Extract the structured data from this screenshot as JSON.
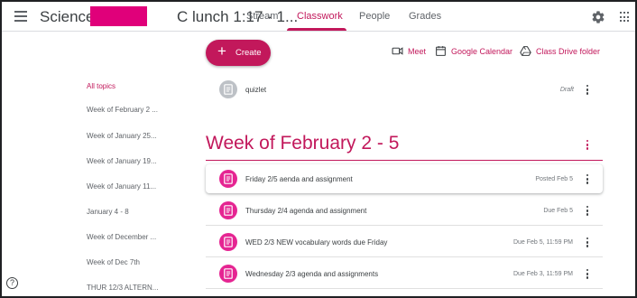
{
  "header": {
    "class_title_prefix": "Science P4",
    "class_title_suffix": "C lunch 1:17 - 1...",
    "tabs": [
      {
        "label": "Stream",
        "active": false
      },
      {
        "label": "Classwork",
        "active": true
      },
      {
        "label": "People",
        "active": false
      },
      {
        "label": "Grades",
        "active": false
      }
    ],
    "accent_color": "#c2185b",
    "icons": [
      "menu-icon",
      "gear-icon",
      "apps-icon"
    ]
  },
  "toolbar": {
    "create_label": "Create",
    "meet_label": "Meet",
    "calendar_label": "Google Calendar",
    "drive_label": "Class Drive folder"
  },
  "topics": {
    "items": [
      {
        "label": "All topics",
        "active": true
      },
      {
        "label": "Week of February 2 ...",
        "active": false
      },
      {
        "label": "Week of January 25...",
        "active": false
      },
      {
        "label": "Week of January 19...",
        "active": false
      },
      {
        "label": "Week of January 11...",
        "active": false
      },
      {
        "label": "January 4 - 8",
        "active": false
      },
      {
        "label": "Week of December ...",
        "active": false
      },
      {
        "label": "Week of Dec 7th",
        "active": false
      },
      {
        "label": "THUR 12/3 ALTERN...",
        "active": false
      }
    ]
  },
  "draft_item": {
    "title": "quizlet",
    "status": "Draft"
  },
  "section": {
    "title": "Week of February 2 - 5",
    "items": [
      {
        "title": "Friday 2/5 aenda and assignment",
        "status": "Posted Feb 5"
      },
      {
        "title": "Thursday 2/4 agenda and assignment",
        "status": "Due Feb 5"
      },
      {
        "title": "WED 2/3 NEW vocabulary words due Friday",
        "status": "Due Feb 5, 11:59 PM"
      },
      {
        "title": "Wednesday 2/3 agenda and assignments",
        "status": "Due Feb 3, 11:59 PM"
      }
    ]
  },
  "help": {
    "glyph": "?"
  }
}
